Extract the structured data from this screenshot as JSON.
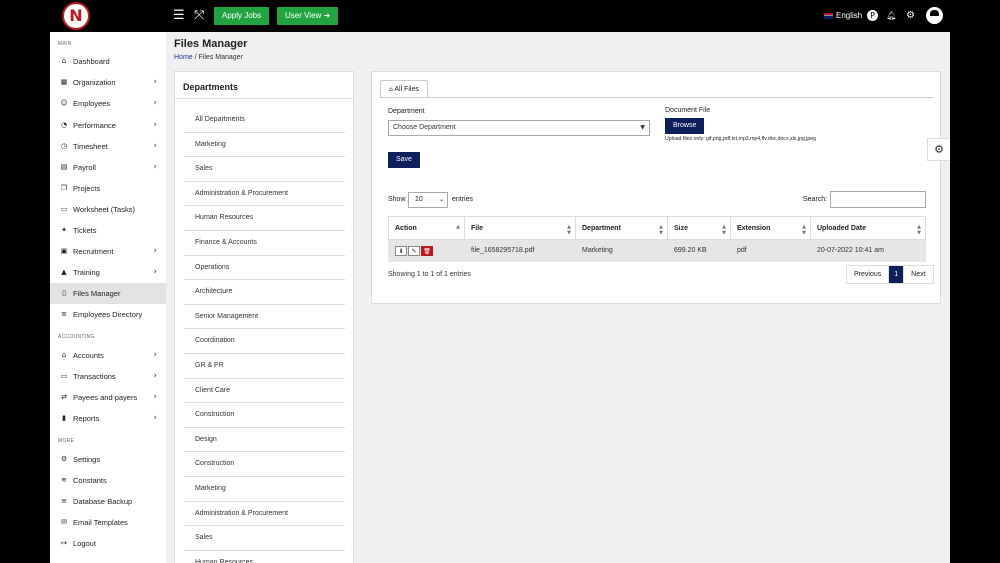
{
  "topbar": {
    "apply_jobs": "Apply Jobs",
    "user_view": "User View",
    "language": "English"
  },
  "sidebar": {
    "section_main": "MAIN",
    "section_accounting": "ACCOUNTING",
    "section_more": "MORE",
    "items": [
      {
        "label": "Dashboard",
        "icon": "home-icon",
        "arrow": false
      },
      {
        "label": "Organization",
        "icon": "building-icon",
        "arrow": true
      },
      {
        "label": "Employees",
        "icon": "user-icon",
        "arrow": true
      },
      {
        "label": "Performance",
        "icon": "gauge-icon",
        "arrow": true
      },
      {
        "label": "Timesheet",
        "icon": "clock-icon",
        "arrow": true
      },
      {
        "label": "Payroll",
        "icon": "calculator-icon",
        "arrow": true
      },
      {
        "label": "Projects",
        "icon": "copy-icon",
        "arrow": false
      },
      {
        "label": "Worksheet (Tasks)",
        "icon": "document-icon",
        "arrow": false
      },
      {
        "label": "Tickets",
        "icon": "ticket-icon",
        "arrow": false
      },
      {
        "label": "Recruitment",
        "icon": "id-card-icon",
        "arrow": true
      },
      {
        "label": "Training",
        "icon": "graduation-icon",
        "arrow": true
      },
      {
        "label": "Files Manager",
        "icon": "file-icon",
        "arrow": false
      },
      {
        "label": "Employees Directory",
        "icon": "database-icon",
        "arrow": false
      },
      {
        "label": "Accounts",
        "icon": "bank-icon",
        "arrow": true
      },
      {
        "label": "Transactions",
        "icon": "money-icon",
        "arrow": true
      },
      {
        "label": "Payees and payers",
        "icon": "exchange-icon",
        "arrow": true
      },
      {
        "label": "Reports",
        "icon": "bar-chart-icon",
        "arrow": true
      },
      {
        "label": "Settings",
        "icon": "gear-icon",
        "arrow": false
      },
      {
        "label": "Constants",
        "icon": "layers-icon",
        "arrow": false
      },
      {
        "label": "Database Backup",
        "icon": "database-icon",
        "arrow": false
      },
      {
        "label": "Email Templates",
        "icon": "envelope-icon",
        "arrow": false
      },
      {
        "label": "Logout",
        "icon": "logout-icon",
        "arrow": false
      }
    ]
  },
  "page": {
    "title": "Files Manager",
    "breadcrumb_home": "Home",
    "breadcrumb_sep": "/",
    "breadcrumb_current": "Files Manager"
  },
  "departments": {
    "title": "Departments",
    "items": [
      "All Departments",
      "Marketing",
      "Sales",
      "Administration & Procurement",
      "Human Resources",
      "Finance & Accounts",
      "Operations",
      "Architecture",
      "Senior Management",
      "Coordination",
      "GR & PR",
      "Client Care",
      "Construction",
      "Design",
      "Construction",
      "Marketing",
      "Administration & Procurement",
      "Sales",
      "Human Resources"
    ]
  },
  "files": {
    "tab_label": "All Files",
    "department_label": "Department",
    "department_placeholder": "Choose Department",
    "document_label": "Document File",
    "browse_label": "Browse",
    "upload_hint": "Upload files only: gif,png,pdf,txt,mp3,mp4,flv,doc,docx,xls,jpg,jpeg",
    "save_label": "Save",
    "show_label": "Show",
    "show_value": "10",
    "entries_label": "entries",
    "search_label": "Search:",
    "columns": [
      "Action",
      "File",
      "Department",
      "Size",
      "Extension",
      "Uploaded Date"
    ],
    "rows": [
      {
        "file": "file_1658295718.pdf",
        "department": "Marketing",
        "size": "699.20 KB",
        "extension": "pdf",
        "uploaded": "20-07-2022 10:41 am"
      }
    ],
    "showing": "Showing 1 to 1 of 1 entries",
    "previous": "Previous",
    "page": "1",
    "next": "Next"
  }
}
